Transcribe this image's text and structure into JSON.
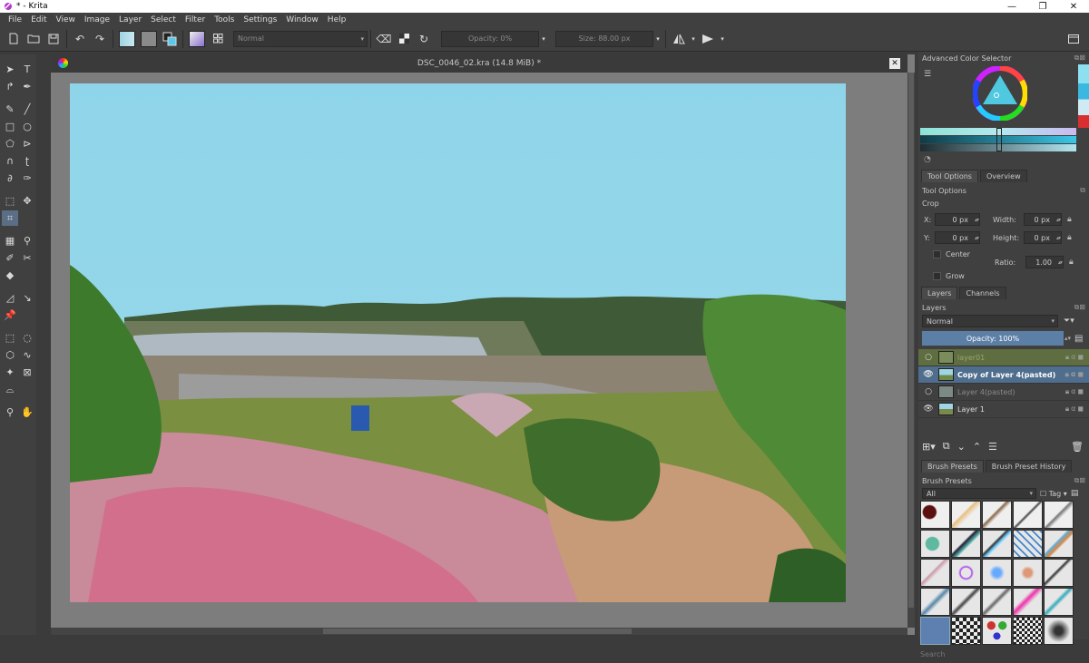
{
  "window": {
    "title": "* - Krita",
    "minimize": "—",
    "restore": "❐",
    "close": "✕"
  },
  "menu": [
    "File",
    "Edit",
    "View",
    "Image",
    "Layer",
    "Select",
    "Filter",
    "Tools",
    "Settings",
    "Window",
    "Help"
  ],
  "toolbar": {
    "blend_mode": "Normal",
    "opacity_label": "Opacity: 0%",
    "size_label": "Size: 88.00 px"
  },
  "document": {
    "tab_title": "DSC_0046_02.kra (14.8 MiB) *",
    "close": "✕"
  },
  "color_selector": {
    "title": "Advanced Color Selector"
  },
  "tool_options": {
    "tabs": [
      "Tool Options",
      "Overview"
    ],
    "title": "Tool Options",
    "tool_name": "Crop",
    "x_label": "X:",
    "x_value": "0 px",
    "y_label": "Y:",
    "y_value": "0 px",
    "width_label": "Width:",
    "width_value": "0 px",
    "height_label": "Height:",
    "height_value": "0 px",
    "ratio_label": "Ratio:",
    "ratio_value": "1.00",
    "center_label": "Center",
    "grow_label": "Grow"
  },
  "layers": {
    "tabs": [
      "Layers",
      "Channels"
    ],
    "title": "Layers",
    "blend_mode": "Normal",
    "opacity": "Opacity: 100%",
    "items": [
      {
        "name": "layer01"
      },
      {
        "name": "Copy of Layer 4(pasted)"
      },
      {
        "name": "Layer 4(pasted)"
      },
      {
        "name": "Layer 1"
      }
    ]
  },
  "brush_presets": {
    "tabs": [
      "Brush Presets",
      "Brush Preset History"
    ],
    "title": "Brush Presets",
    "filter": "All",
    "tag_label": "Tag",
    "search_label": "Search"
  }
}
